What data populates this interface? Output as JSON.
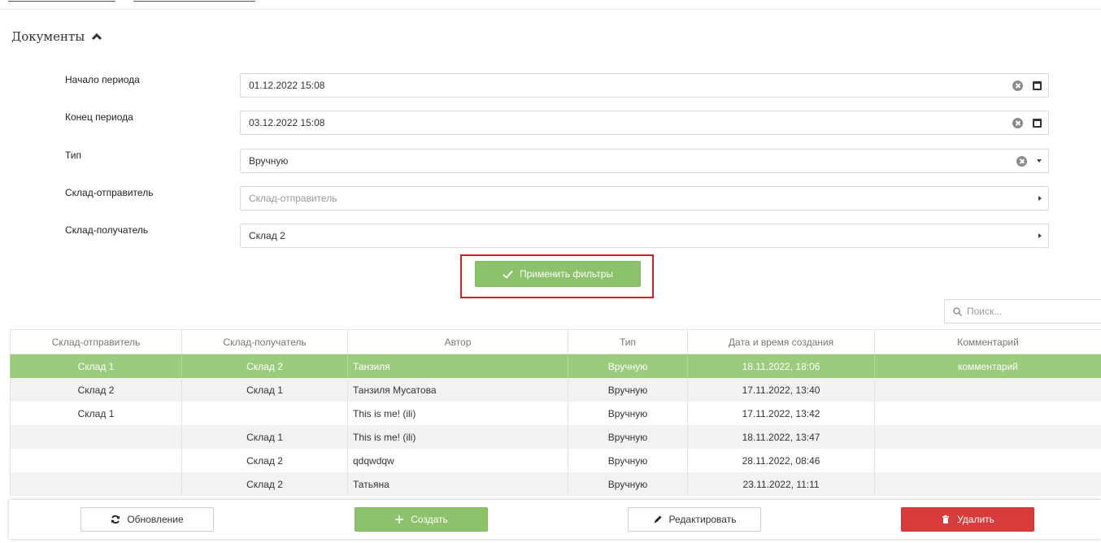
{
  "section": {
    "title": "Документы"
  },
  "filters": [
    {
      "label": "Начало периода",
      "value": "01.12.2022 15:08",
      "placeholder": "",
      "controls": [
        "clear-icon",
        "calendar-icon"
      ]
    },
    {
      "label": "Конец периода",
      "value": "03.12.2022 15:08",
      "placeholder": "",
      "controls": [
        "clear-icon",
        "calendar-icon"
      ]
    },
    {
      "label": "Тип",
      "value": "Вручную",
      "placeholder": "",
      "controls": [
        "clear-icon",
        "caret-down-icon"
      ]
    },
    {
      "label": "Склад-отправитель",
      "value": "",
      "placeholder": "Склад-отправитель",
      "controls": [
        "caret-right-icon"
      ]
    },
    {
      "label": "Склад-получатель",
      "value": "Склад 2",
      "placeholder": "",
      "controls": [
        "caret-right-icon"
      ]
    }
  ],
  "apply_button": {
    "label": "Применить фильтры",
    "icon": "check-icon"
  },
  "search": {
    "placeholder": "Поиск...",
    "icon": "search-icon"
  },
  "table": {
    "columns": [
      "Склад-отправитель",
      "Склад-получатель",
      "Автор",
      "Тип",
      "Дата и время создания",
      "Комментарий"
    ],
    "rows": [
      [
        "Склад 1",
        "Склад 2",
        "Танзиля",
        "Вручную",
        "18.11.2022, 18:06",
        "комментарий"
      ],
      [
        "Склад 2",
        "Склад 1",
        "Танзиля Мусатова",
        "Вручную",
        "17.11.2022, 13:40",
        ""
      ],
      [
        "Склад 1",
        "",
        "This is me! (ili)",
        "Вручную",
        "17.11.2022, 13:42",
        ""
      ],
      [
        "",
        "Склад 1",
        "This is me! (ili)",
        "Вручную",
        "18.11.2022, 13:47",
        ""
      ],
      [
        "",
        "Склад 2",
        "qdqwdqw",
        "Вручную",
        "28.11.2022, 08:46",
        ""
      ],
      [
        "",
        "Склад 2",
        "Татьяна",
        "Вручную",
        "23.11.2022, 11:11",
        ""
      ]
    ],
    "selected_row": 0
  },
  "toolbar": {
    "refresh_label": "Обновление",
    "create_label": "Создать",
    "edit_label": "Редактировать",
    "delete_label": "Удалить"
  },
  "colors": {
    "accent_green": "#8cc26b",
    "selected_row": "#9bcb7c",
    "danger_red": "#d83b3b",
    "highlight_border": "#d42020"
  }
}
